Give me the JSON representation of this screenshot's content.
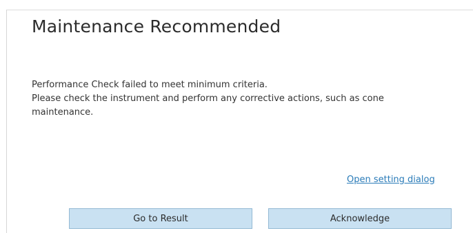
{
  "dialog": {
    "title": "Maintenance Recommended",
    "message_lines": [
      "Performance Check failed to meet minimum criteria.",
      "Please check the instrument and perform any corrective actions, such as cone maintenance."
    ],
    "link_label": "Open setting dialog",
    "buttons": {
      "go_to_result": "Go to Result",
      "acknowledge": "Acknowledge"
    }
  }
}
